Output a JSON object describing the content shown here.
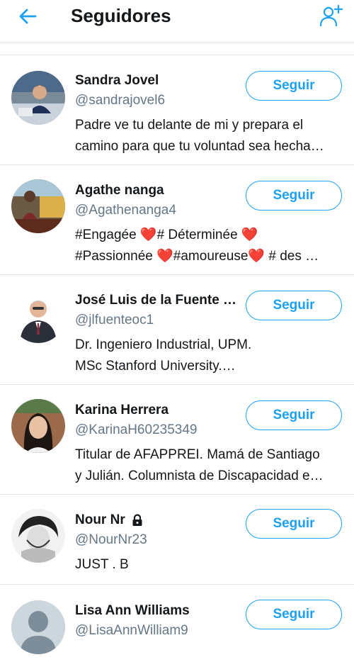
{
  "header": {
    "title": "Seguidores",
    "back_icon": "arrow-left-icon",
    "add_icon": "add-user-icon"
  },
  "colors": {
    "accent": "#1da1f2",
    "secondary_text": "#657786",
    "divider": "#e1e8ed",
    "heart": "#e0245e"
  },
  "followers": [
    {
      "name": "Sandra Jovel",
      "handle": "@sandrajovel6",
      "bio": [
        "Padre ve tu delante de mi y prepara el",
        "camino para que tu voluntad sea hecha…"
      ],
      "button": "Seguir",
      "avatar": "photo"
    },
    {
      "name": "Agathe nanga",
      "handle": "@Agathenanga4",
      "bio": [
        "#Engagée ❤️# Déterminée ❤️",
        "#Passionnée ❤️#amoureuse❤️ # des …"
      ],
      "button": "Seguir",
      "avatar": "photo"
    },
    {
      "name": "José Luis de la Fuente …",
      "handle": "@jlfuenteoc1",
      "bio": [
        "Dr. Ingeniero Industrial, UPM.",
        "MSc Stanford University.…"
      ],
      "button": "Seguir",
      "avatar": "photo"
    },
    {
      "name": "Karina Herrera",
      "handle": "@KarinaH60235349",
      "bio": [
        "Titular de AFAPPREI. Mamá de Santiago",
        "y Julián. Columnista de Discapacidad e…"
      ],
      "button": "Seguir",
      "avatar": "photo"
    },
    {
      "name": "Nour Nr",
      "handle": "@NourNr23",
      "bio": [
        "JUST . B"
      ],
      "button": "Seguir",
      "avatar": "photo",
      "protected_icon": "lock-icon"
    },
    {
      "name": "Lisa Ann Williams",
      "handle": "@LisaAnnWilliam9",
      "bio": [],
      "button": "Seguir",
      "avatar": "default"
    }
  ]
}
